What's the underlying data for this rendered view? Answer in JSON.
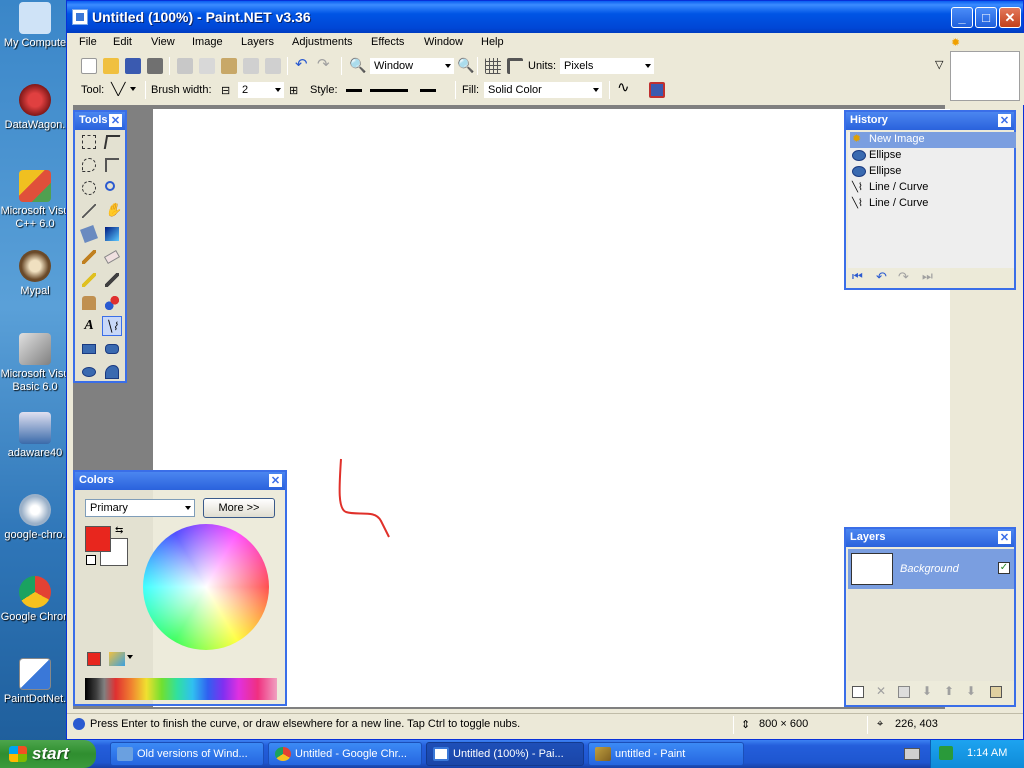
{
  "desktop": {
    "icons": [
      {
        "label": "My Compute",
        "color": "#cfe3f7"
      },
      {
        "label": "DataWagon.",
        "color": "#b02a2a"
      },
      {
        "label": "Microsoft Visu",
        "label2": "C++ 6.0",
        "color": "#e0503a"
      },
      {
        "label": "Mypal",
        "color": "#6a4a2a"
      },
      {
        "label": "Microsoft Visu",
        "label2": "Basic 6.0",
        "color": "#d0d0d0"
      },
      {
        "label": "adaware40",
        "color": "#3a6aaa"
      },
      {
        "label": "google-chro.",
        "color": "#9ab0c8"
      },
      {
        "label": "Google Chron",
        "color": "#e34133"
      },
      {
        "label": "PaintDotNet.",
        "color": "#3a78d8"
      }
    ]
  },
  "window": {
    "title": "Untitled (100%) - Paint.NET v3.36",
    "controls": {
      "minimize": "_",
      "maximize": "□",
      "close": "✕"
    }
  },
  "menu": [
    "File",
    "Edit",
    "View",
    "Image",
    "Layers",
    "Adjustments",
    "Effects",
    "Window",
    "Help"
  ],
  "toolbar1": {
    "zoom_value": "Window",
    "units_label": "Units:",
    "units_value": "Pixels"
  },
  "toolbar2": {
    "tool_label": "Tool:",
    "brush_label": "Brush width:",
    "brush_value": "2",
    "minus": "⊟",
    "plus": "⊞",
    "style_label": "Style:",
    "fill_label": "Fill:",
    "fill_value": "Solid Color"
  },
  "tools_panel": {
    "title": "Tools",
    "close": "✕"
  },
  "history_panel": {
    "title": "History",
    "close": "✕",
    "items": [
      {
        "label": "New Image",
        "selected": true
      },
      {
        "label": "Ellipse",
        "selected": false
      },
      {
        "label": "Ellipse",
        "selected": false
      },
      {
        "label": "Line / Curve",
        "selected": false
      },
      {
        "label": "Line / Curve",
        "selected": false
      }
    ]
  },
  "colors_panel": {
    "title": "Colors",
    "close": "✕",
    "mode": "Primary",
    "more_button": "More >>",
    "primary_color": "#e8261e",
    "secondary_color": "#ffffff"
  },
  "layers_panel": {
    "title": "Layers",
    "close": "✕",
    "layers": [
      {
        "name": "Background",
        "visible": true
      }
    ]
  },
  "status": {
    "message": "Press Enter to finish the curve, or draw elsewhere for a new line. Tap Ctrl to toggle nubs.",
    "image_size": "800 × 600",
    "cursor_pos": "226, 403"
  },
  "taskbar": {
    "start_label": "start",
    "tasks": [
      {
        "label": "Old versions of Wind...",
        "active": false,
        "color": "#6aa0e0"
      },
      {
        "label": "Untitled - Google Chr...",
        "active": false,
        "color": "#e34133"
      },
      {
        "label": "Untitled (100%) - Pai...",
        "active": true,
        "color": "#3a78d8"
      },
      {
        "label": "untitled - Paint",
        "active": false,
        "color": "#c0a040"
      }
    ],
    "clock": "1:14 AM"
  }
}
